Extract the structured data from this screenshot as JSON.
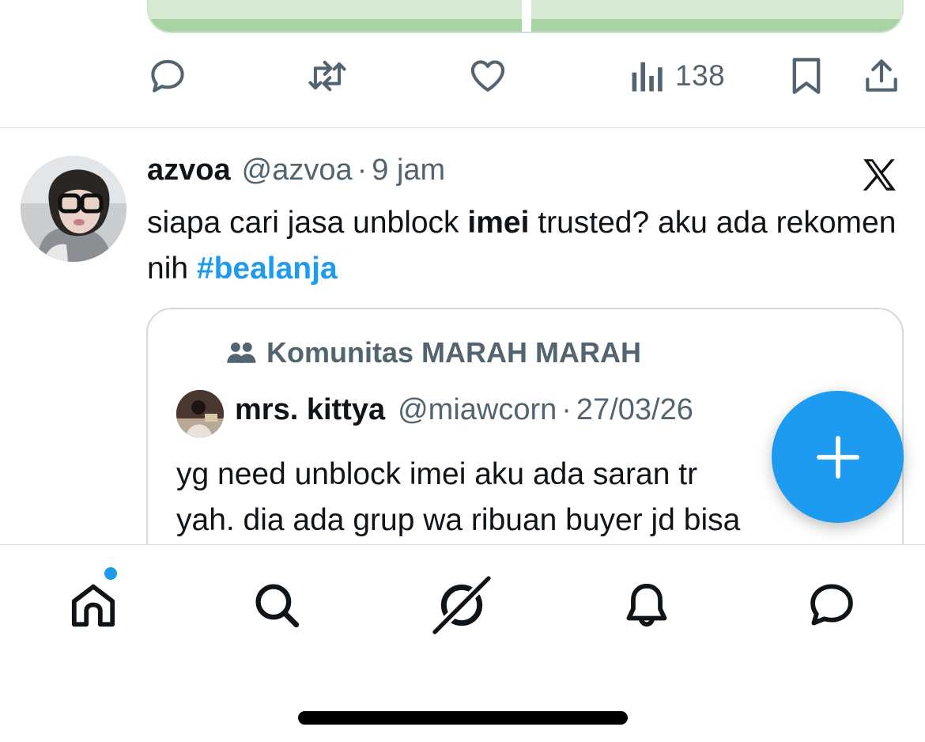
{
  "previous_tweet": {
    "views_count": "138"
  },
  "tweet": {
    "display_name": "azvoa",
    "handle": "@azvoa",
    "separator": "·",
    "time": "9 jam",
    "text_parts": {
      "part1": "siapa cari jasa unblock ",
      "bold": "imei",
      "part2": " trusted? aku ada rekomen nih ",
      "hashtag": "#bealanja"
    },
    "quote": {
      "community_label": "Komunitas MARAH MARAH",
      "display_name": "mrs. kittya",
      "handle": "@miawcorn",
      "separator": "·",
      "date": "27/03/26",
      "line1": "yg need unblock imei aku ada saran tr",
      "line2": "yah. dia ada grup wa ribuan buyer jd bisa"
    }
  },
  "icons": {
    "reply": "reply-icon",
    "retweet": "retweet-icon",
    "like": "heart-icon",
    "views": "views-icon",
    "bookmark": "bookmark-icon",
    "share": "share-icon",
    "brand": "x-logo-icon",
    "compose": "plus-icon",
    "nav": [
      "home-icon",
      "search-icon",
      "grok-icon",
      "bell-icon",
      "messages-icon"
    ]
  },
  "colors": {
    "accent": "#1d9bf0",
    "text_primary": "#0f1419",
    "text_secondary": "#536471",
    "border": "#cfd9de"
  }
}
